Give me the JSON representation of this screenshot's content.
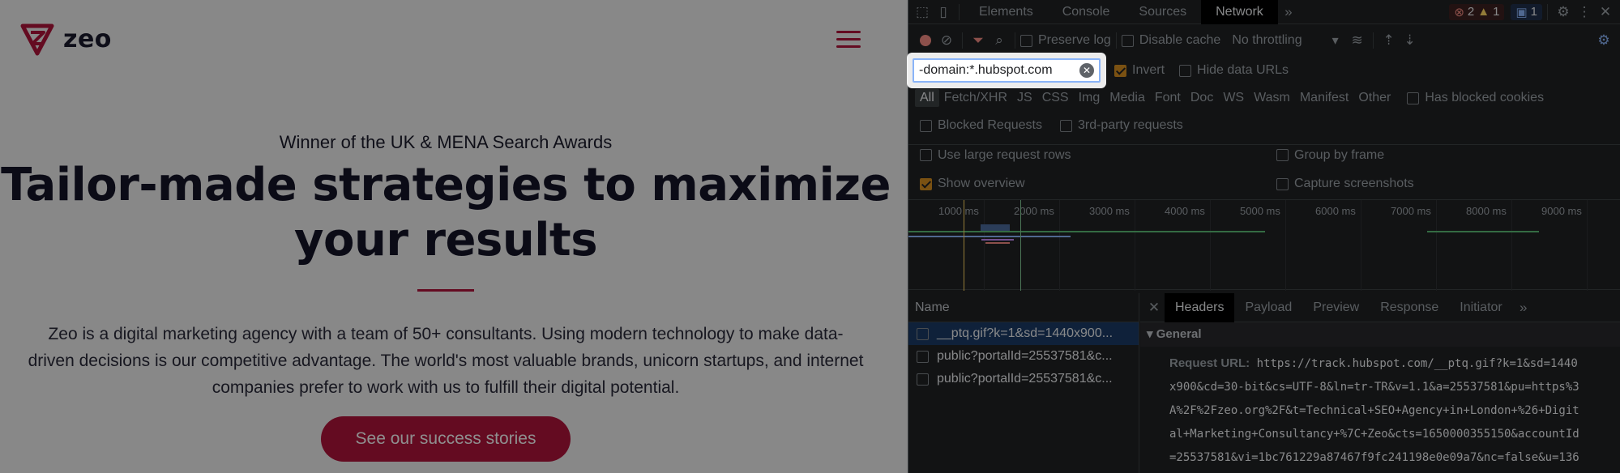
{
  "site": {
    "logo_text": "zeo",
    "kicker": "Winner of the UK & MENA Search Awards",
    "hero_line1": "Tailor-made strategies to maximize",
    "hero_line2": "your results",
    "lead_line1": "Zeo is a digital marketing agency with a team of 50+ consultants. Using modern technology to make data-",
    "lead_line2": "driven decisions is our competitive advantage. The world's most valuable brands, unicorn startups, and internet",
    "lead_line3": "companies prefer to work with us to fulfill their digital potential.",
    "cta": "See our success stories",
    "brand_color": "#b3143b"
  },
  "devtools": {
    "tabs": [
      "Elements",
      "Console",
      "Sources",
      "Network"
    ],
    "active_tab": "Network",
    "errors": "2",
    "warnings": "1",
    "messages": "1",
    "toolbar": {
      "preserve_log": "Preserve log",
      "disable_cache": "Disable cache",
      "throttling": "No throttling"
    },
    "filter": {
      "value": "-domain:*.hubspot.com",
      "invert": "Invert",
      "hide_data_urls": "Hide data URLs"
    },
    "types": [
      "All",
      "Fetch/XHR",
      "JS",
      "CSS",
      "Img",
      "Media",
      "Font",
      "Doc",
      "WS",
      "Wasm",
      "Manifest",
      "Other"
    ],
    "has_blocked_cookies": "Has blocked cookies",
    "blocked_requests": "Blocked Requests",
    "third_party": "3rd-party requests",
    "use_large_rows": "Use large request rows",
    "group_by_frame": "Group by frame",
    "show_overview": "Show overview",
    "capture_screenshots": "Capture screenshots",
    "ticks": [
      "1000 ms",
      "2000 ms",
      "3000 ms",
      "4000 ms",
      "5000 ms",
      "6000 ms",
      "7000 ms",
      "8000 ms",
      "9000 ms"
    ],
    "requests_header": "Name",
    "requests": [
      "__ptq.gif?k=1&sd=1440x900...",
      "public?portalId=25537581&c...",
      "public?portalId=25537581&c..."
    ],
    "detail_tabs": [
      "Headers",
      "Payload",
      "Preview",
      "Response",
      "Initiator"
    ],
    "general_label": "General",
    "request_url_label": "Request URL:",
    "request_url_lines": [
      "https://track.hubspot.com/__ptq.gif?k=1&sd=1440",
      "x900&cd=30-bit&cs=UTF-8&ln=tr-TR&v=1.1&a=25537581&pu=https%3",
      "A%2F%2Fzeo.org%2F&t=Technical+SEO+Agency+in+London+%26+Digit",
      "al+Marketing+Consultancy+%7C+Zeo&cts=1650000355150&accountId",
      "=25537581&vi=1bc761229a87467f9fc241198e0e09a7&nc=false&u=136"
    ]
  }
}
